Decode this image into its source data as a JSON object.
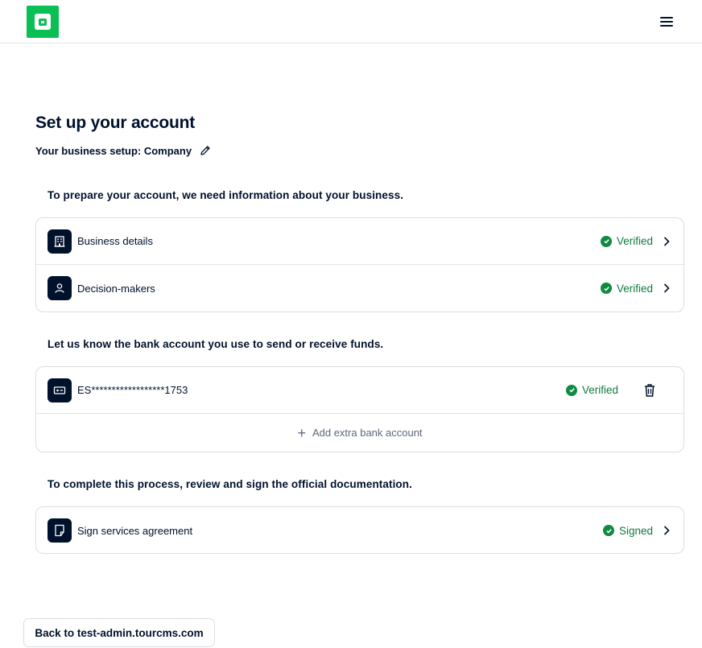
{
  "header": {
    "logo_icon": "adyen-logo-icon",
    "menu_icon": "hamburger-menu-icon"
  },
  "page": {
    "title": "Set up your account",
    "business_setup": "Your business setup: Company"
  },
  "sections": {
    "business_heading": "To prepare your account, we need information about your business.",
    "bank_heading": "Let us know the bank account you use to send or receive funds.",
    "docs_heading": "To complete this process, review and sign the official documentation."
  },
  "business_items": [
    {
      "label": "Business details",
      "status": "Verified",
      "icon": "building-icon"
    },
    {
      "label": "Decision-makers",
      "status": "Verified",
      "icon": "person-icon"
    }
  ],
  "bank": {
    "account": "ES******************1753",
    "status": "Verified",
    "icon": "bank-card-icon",
    "add_label": "Add extra bank account"
  },
  "documents": [
    {
      "label": "Sign services agreement",
      "status": "Signed",
      "icon": "document-icon"
    }
  ],
  "footer": {
    "back_label": "Back to test-admin.tourcms.com"
  },
  "colors": {
    "brand": "#0abf53",
    "text": "#00112c",
    "success": "#0f7a3d",
    "border": "#dbdee2"
  }
}
